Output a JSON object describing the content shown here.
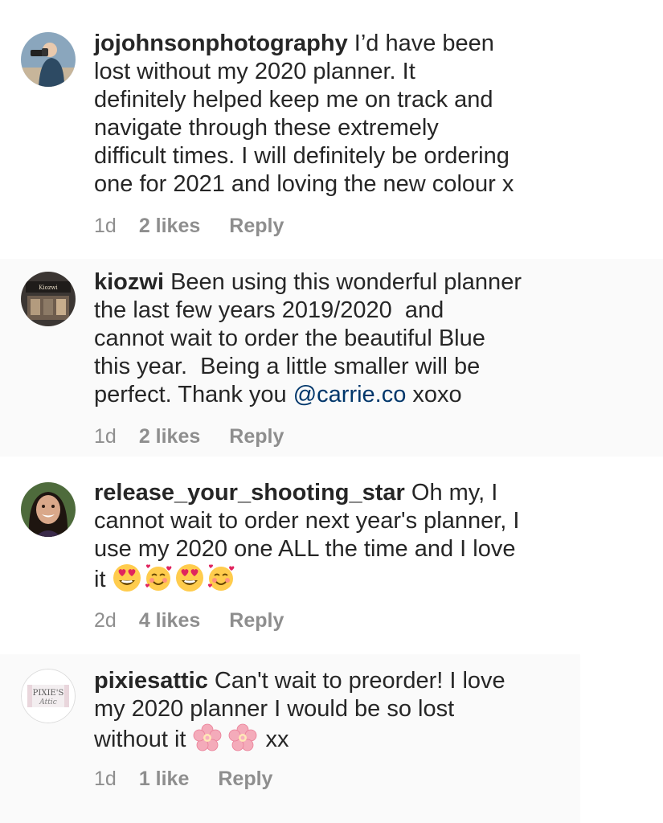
{
  "comments": [
    {
      "username": "jojohnsonphotography",
      "avatar_icon": "photographer-avatar",
      "text_lines": [
        "I’d have been",
        "lost without my 2020 planner. It",
        "definitely helped keep me on track and",
        "navigate through these extremely",
        "difficult times. I will definitely be ordering",
        "one for 2021 and loving the new colour x"
      ],
      "time": "1d",
      "likes": "2 likes",
      "reply": "Reply"
    },
    {
      "username": "kiozwi",
      "avatar_icon": "shop-front-avatar",
      "text_before_mention": "Been using this wonderful planner\nthe last few years 2019/2020  and\ncannot wait to order the beautiful Blue\nthis year.  Being a little smaller will be\nperfect. Thank you ",
      "mention": "@carrie.co",
      "text_after_mention": " xoxo",
      "time": "1d",
      "likes": "2 likes",
      "reply": "Reply"
    },
    {
      "username": "release_your_shooting_star",
      "avatar_icon": "smiling-woman-avatar",
      "text": "Oh my, I\ncannot wait to order next year's planner, I\nuse my 2020 one ALL the time and I love\nit ",
      "emojis": [
        "heart-eyes-emoji",
        "smiling-face-with-hearts-emoji",
        "heart-eyes-emoji",
        "smiling-face-with-hearts-emoji"
      ],
      "time": "2d",
      "likes": "4 likes",
      "reply": "Reply"
    },
    {
      "username": "pixiesattic",
      "avatar_icon": "pixies-attic-logo-avatar",
      "avatar_logo_text": "PIXIE'S Attic",
      "text": "Can't wait to preorder! I love\nmy 2020 planner I would be so lost\nwithout it ",
      "emojis": [
        "cherry-blossom-emoji",
        "cherry-blossom-emoji"
      ],
      "text_after_emojis": " xx",
      "time": "1d",
      "likes": "1 like",
      "reply": "Reply"
    }
  ],
  "colors": {
    "text": "#262626",
    "meta": "#8e8e8e",
    "mention": "#00376b",
    "shaded_background": "#fafafa"
  }
}
